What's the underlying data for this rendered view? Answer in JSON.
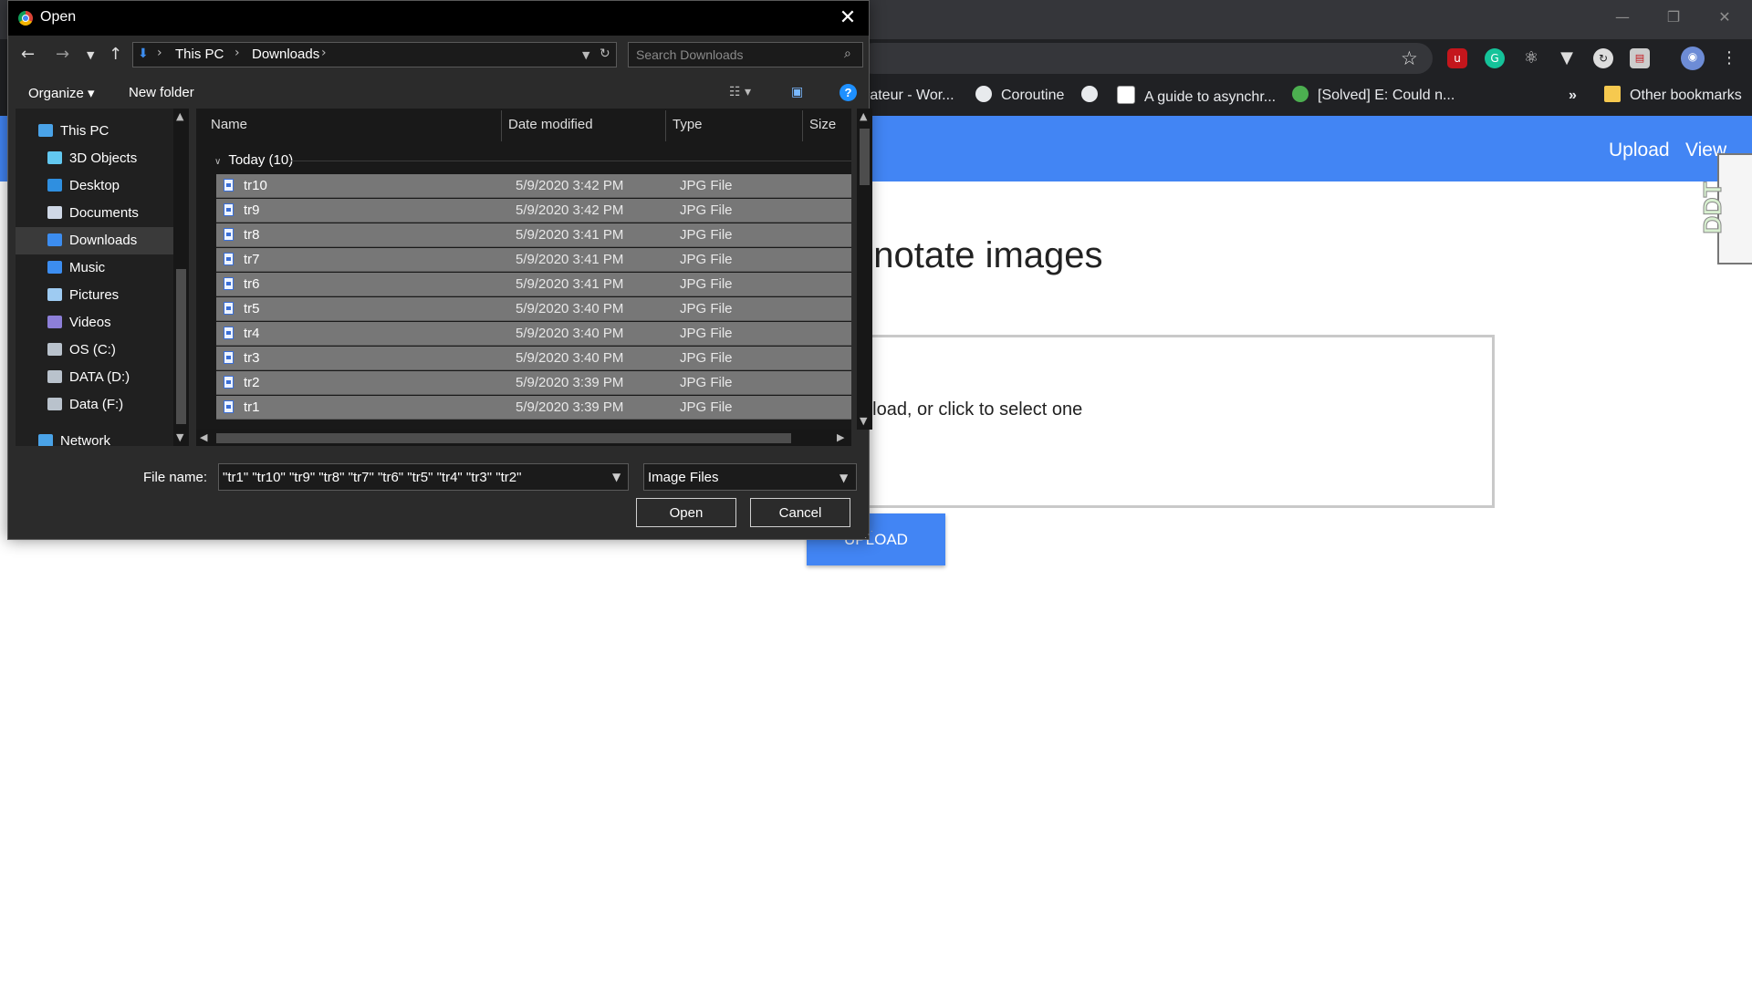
{
  "browser": {
    "window_controls": {
      "minimize": "—",
      "restore": "❐",
      "close": "✕"
    },
    "bookmarks": [
      {
        "label": "rateur - Wor...",
        "icon": "none"
      },
      {
        "label": "Coroutine",
        "icon": "globe-icon"
      },
      {
        "label": "",
        "icon": "globe-icon"
      },
      {
        "label": "A guide to asynchr...",
        "icon": "angular-icon"
      },
      {
        "label": "[Solved] E: Could n...",
        "icon": "gear-icon"
      }
    ],
    "bookmarks_overflow": "»",
    "other_bookmarks": "Other bookmarks"
  },
  "page": {
    "nav": {
      "upload": "Upload",
      "view": "View"
    },
    "side_widget": "DDT",
    "title": "nnotate images",
    "drop_text": "pload, or click to select one",
    "upload_button": "UPLOAD"
  },
  "dialog": {
    "title": "Open",
    "close": "✕",
    "breadcrumb": [
      "This PC",
      "Downloads"
    ],
    "search_placeholder": "Search Downloads",
    "organize": "Organize",
    "new_folder": "New folder",
    "help": "?",
    "tree": [
      {
        "label": "This PC",
        "icon": "computer-icon"
      },
      {
        "label": "3D Objects",
        "icon": "cube-icon"
      },
      {
        "label": "Desktop",
        "icon": "desktop-icon"
      },
      {
        "label": "Documents",
        "icon": "document-icon"
      },
      {
        "label": "Downloads",
        "icon": "download-icon",
        "selected": true
      },
      {
        "label": "Music",
        "icon": "music-icon"
      },
      {
        "label": "Pictures",
        "icon": "pictures-icon"
      },
      {
        "label": "Videos",
        "icon": "video-icon"
      },
      {
        "label": "OS (C:)",
        "icon": "drive-icon"
      },
      {
        "label": "DATA (D:)",
        "icon": "drive-icon"
      },
      {
        "label": "Data (F:)",
        "icon": "drive-icon"
      },
      {
        "label": "Network",
        "icon": "network-icon"
      }
    ],
    "columns": {
      "name": "Name",
      "date": "Date modified",
      "type": "Type",
      "size": "Size"
    },
    "group": "Today (10)",
    "files": [
      {
        "name": "tr10",
        "date": "5/9/2020 3:42 PM",
        "type": "JPG File"
      },
      {
        "name": "tr9",
        "date": "5/9/2020 3:42 PM",
        "type": "JPG File"
      },
      {
        "name": "tr8",
        "date": "5/9/2020 3:41 PM",
        "type": "JPG File"
      },
      {
        "name": "tr7",
        "date": "5/9/2020 3:41 PM",
        "type": "JPG File"
      },
      {
        "name": "tr6",
        "date": "5/9/2020 3:41 PM",
        "type": "JPG File"
      },
      {
        "name": "tr5",
        "date": "5/9/2020 3:40 PM",
        "type": "JPG File"
      },
      {
        "name": "tr4",
        "date": "5/9/2020 3:40 PM",
        "type": "JPG File"
      },
      {
        "name": "tr3",
        "date": "5/9/2020 3:40 PM",
        "type": "JPG File"
      },
      {
        "name": "tr2",
        "date": "5/9/2020 3:39 PM",
        "type": "JPG File"
      },
      {
        "name": "tr1",
        "date": "5/9/2020 3:39 PM",
        "type": "JPG File"
      }
    ],
    "file_name_label": "File name:",
    "file_name_value": "\"tr1\" \"tr10\" \"tr9\" \"tr8\" \"tr7\" \"tr6\" \"tr5\" \"tr4\" \"tr3\" \"tr2\"",
    "file_type": "Image Files",
    "open_button": "Open",
    "cancel_button": "Cancel"
  },
  "colors": {
    "header_blue": "#4285f4",
    "dialog_bg": "#2b2b2b",
    "selected_row": "#777777"
  }
}
